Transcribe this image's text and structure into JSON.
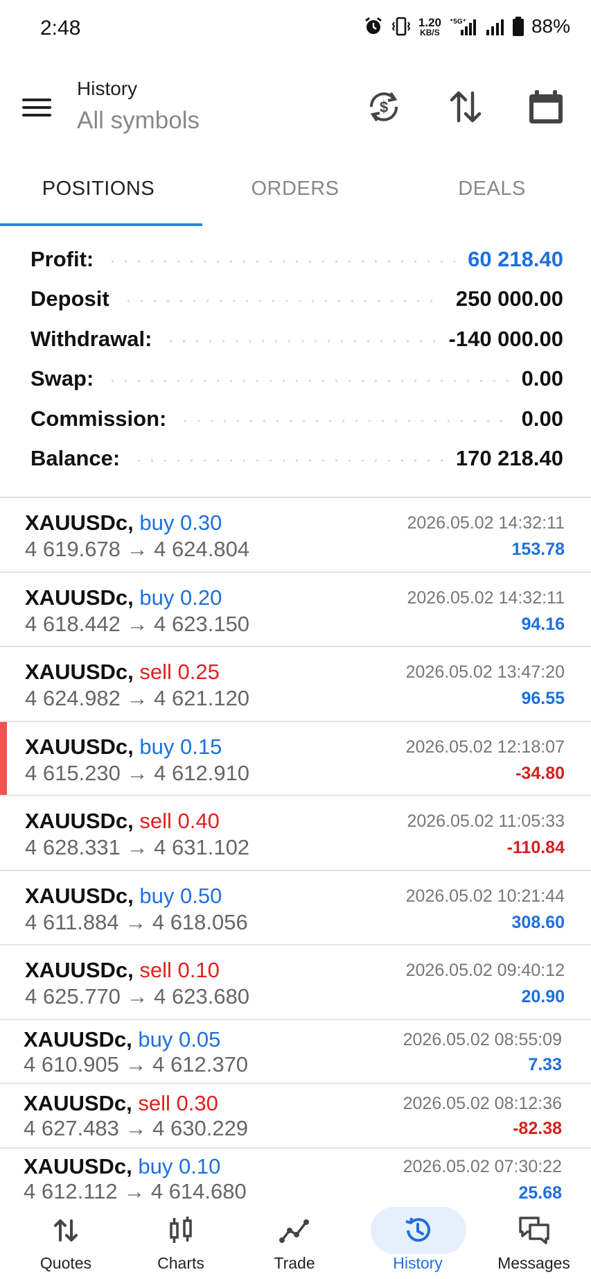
{
  "status_bar": {
    "time": "2:48",
    "net_speed": "1.20",
    "net_unit": "KB/S",
    "network": "5G",
    "battery": "88%",
    "icons": [
      "alarm-icon",
      "vibrate-icon",
      "signal-icon",
      "battery-icon"
    ]
  },
  "header": {
    "title": "History",
    "subtitle": "All symbols",
    "icons": [
      "currency-exchange-icon",
      "sort-icon",
      "calendar-icon"
    ]
  },
  "tabs": [
    {
      "label": "POSITIONS",
      "active": true
    },
    {
      "label": "ORDERS",
      "active": false
    },
    {
      "label": "DEALS",
      "active": false
    }
  ],
  "summary": [
    {
      "label": "Profit:",
      "value": "60 218.40",
      "highlight": true
    },
    {
      "label": "Deposit",
      "value": "250 000.00",
      "highlight": false
    },
    {
      "label": "Withdrawal:",
      "value": "-140 000.00",
      "highlight": false
    },
    {
      "label": "Swap:",
      "value": "0.00",
      "highlight": false
    },
    {
      "label": "Commission:",
      "value": "0.00",
      "highlight": false
    },
    {
      "label": "Balance:",
      "value": "170 218.40",
      "highlight": false
    }
  ],
  "positions": [
    {
      "symbol": "XAUUSDc,",
      "side": "buy 0.30",
      "type": "buy",
      "prices": "4 619.678 → 4 624.804",
      "time": "2026.05.02 14:32:11",
      "profit": "153.78",
      "profit_sign": "pos"
    },
    {
      "symbol": "XAUUSDc,",
      "side": "buy 0.20",
      "type": "buy",
      "prices": "4 618.442 → 4 623.150",
      "time": "2026.05.02 14:32:11",
      "profit": "94.16",
      "profit_sign": "pos"
    },
    {
      "symbol": "XAUUSDc,",
      "side": "sell 0.25",
      "type": "sell",
      "prices": "4 624.982 → 4 621.120",
      "time": "2026.05.02 13:47:20",
      "profit": "96.55",
      "profit_sign": "pos"
    },
    {
      "symbol": "XAUUSDc,",
      "side": "buy 0.15",
      "type": "buy",
      "prices": "4 615.230 → 4 612.910",
      "time": "2026.05.02 12:18:07",
      "profit": "-34.80",
      "profit_sign": "neg"
    },
    {
      "symbol": "XAUUSDc,",
      "side": "sell 0.40",
      "type": "sell",
      "prices": "4 628.331 → 4 631.102",
      "time": "2026.05.02 11:05:33",
      "profit": "-110.84",
      "profit_sign": "neg"
    },
    {
      "symbol": "XAUUSDc,",
      "side": "buy 0.50",
      "type": "buy",
      "prices": "4 611.884 → 4 618.056",
      "time": "2026.05.02 10:21:44",
      "profit": "308.60",
      "profit_sign": "pos"
    },
    {
      "symbol": "XAUUSDc,",
      "side": "sell 0.10",
      "type": "sell",
      "prices": "4 625.770 → 4 623.680",
      "time": "2026.05.02 09:40:12",
      "profit": "20.90",
      "profit_sign": "pos"
    },
    {
      "symbol": "XAUUSDc,",
      "side": "buy 0.05",
      "type": "buy",
      "prices": "4 610.905 → 4 612.370",
      "time": "2026.05.02 08:55:09",
      "profit": "7.33",
      "profit_sign": "pos"
    },
    {
      "symbol": "XAUUSDc,",
      "side": "sell 0.30",
      "type": "sell",
      "prices": "4 627.483 → 4 630.229",
      "time": "2026.05.02 08:12:36",
      "profit": "-82.38",
      "profit_sign": "neg"
    },
    {
      "symbol": "XAUUSDc,",
      "side": "buy 0.10",
      "type": "buy",
      "prices": "4 612.112 → 4 614.680",
      "time": "2026.05.02 07:30:22",
      "profit": "25.68",
      "profit_sign": "pos"
    }
  ],
  "bottom_nav": [
    {
      "label": "Quotes",
      "icon": "quotes-icon",
      "active": false
    },
    {
      "label": "Charts",
      "icon": "charts-icon",
      "active": false
    },
    {
      "label": "Trade",
      "icon": "trade-icon",
      "active": false
    },
    {
      "label": "History",
      "icon": "history-icon",
      "active": true
    },
    {
      "label": "Messages",
      "icon": "messages-icon",
      "active": false
    }
  ],
  "colors": {
    "accent": "#1e6fe0",
    "sell": "#e02020",
    "marker": "#ef5350"
  }
}
